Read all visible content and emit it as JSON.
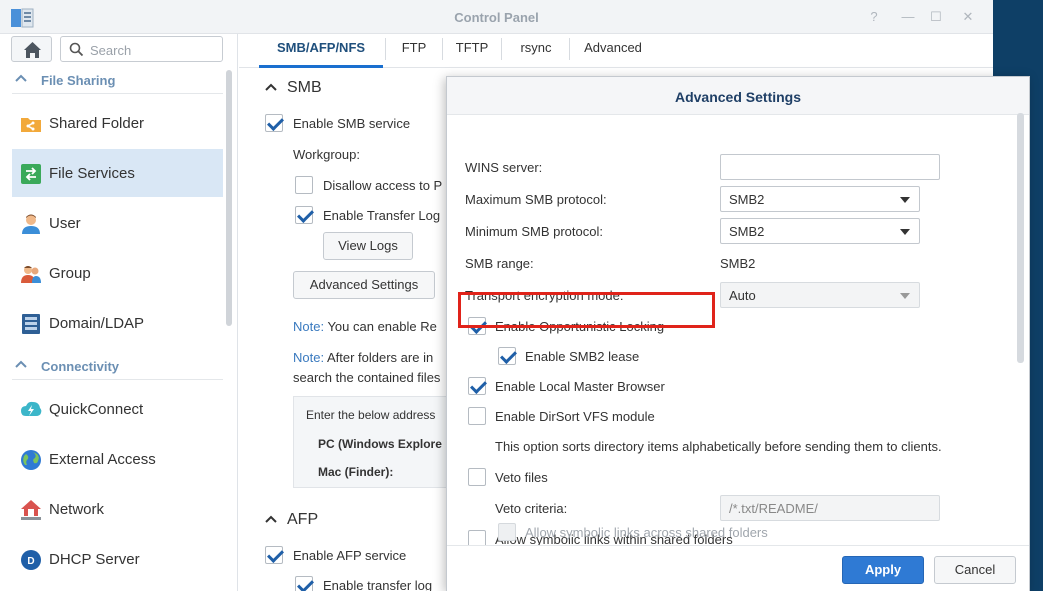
{
  "window": {
    "title": "Control Panel",
    "controls": [
      "?",
      "—",
      "☐",
      "✕"
    ]
  },
  "sidebar": {
    "search_placeholder": "Search",
    "sections": [
      {
        "label": "File Sharing"
      },
      {
        "label": "Connectivity"
      }
    ],
    "items": [
      {
        "label": "Shared Folder",
        "icon": "shared-folder-icon"
      },
      {
        "label": "File Services",
        "icon": "file-services-icon",
        "active": true
      },
      {
        "label": "User",
        "icon": "user-icon"
      },
      {
        "label": "Group",
        "icon": "group-icon"
      },
      {
        "label": "Domain/LDAP",
        "icon": "domain-icon"
      },
      {
        "label": "QuickConnect",
        "icon": "quickconnect-icon"
      },
      {
        "label": "External Access",
        "icon": "globe-icon"
      },
      {
        "label": "Network",
        "icon": "network-icon"
      },
      {
        "label": "DHCP Server",
        "icon": "dhcp-icon"
      }
    ]
  },
  "tabs": [
    "SMB/AFP/NFS",
    "FTP",
    "TFTP",
    "rsync",
    "Advanced"
  ],
  "main": {
    "smb_title": "SMB",
    "enable_smb": "Enable SMB service",
    "workgroup_label": "Workgroup:",
    "disallow_label": "Disallow access to P",
    "transfer_log_label": "Enable Transfer Log",
    "view_logs_btn": "View Logs",
    "advanced_settings_btn": "Advanced Settings",
    "note1_prefix": "Note:",
    "note1_text": " You can enable Re",
    "note2_prefix": "Note:",
    "note2_text": " After folders are in",
    "note2_line2": "search the contained files",
    "address_intro": "Enter the below address",
    "pc_label": "PC (Windows Explore",
    "mac_label": "Mac (Finder):",
    "afp_title": "AFP",
    "enable_afp": "Enable AFP service",
    "afp_transfer_log": "Enable transfer log"
  },
  "dialog": {
    "title": "Advanced Settings",
    "wins_label": "WINS server:",
    "wins_value": "",
    "max_smb_label": "Maximum SMB protocol:",
    "max_smb_value": "SMB2",
    "min_smb_label": "Minimum SMB protocol:",
    "min_smb_value": "SMB2",
    "smb_range_label": "SMB range:",
    "smb_range_value": "SMB2",
    "transport_label": "Transport encryption mode:",
    "transport_value": "Auto",
    "opp_lock_label": "Enable Opportunistic Locking",
    "smb2_lease_label": "Enable SMB2 lease",
    "local_master_label": "Enable Local Master Browser",
    "dirsort_label": "Enable DirSort VFS module",
    "dirsort_desc": "This option sorts directory items alphabetically before sending them to clients.",
    "veto_files_label": "Veto files",
    "veto_criteria_label": "Veto criteria:",
    "veto_criteria_placeholder": "/*.txt/README/",
    "symlinks_label": "Allow symbolic links within shared folders",
    "symlinks_across_label": "Allow symbolic links across shared folders",
    "apply_btn": "Apply",
    "cancel_btn": "Cancel",
    "checks": {
      "opp_lock": true,
      "smb2_lease": true,
      "local_master": true,
      "dirsort": false,
      "veto_files": false,
      "symlinks": false,
      "symlinks_across": false
    }
  },
  "colors": {
    "accent": "#2f7ad4",
    "active_nav_bg": "#d9e7f5",
    "highlight": "#e0231a",
    "section_head": "#6b8fb3"
  }
}
